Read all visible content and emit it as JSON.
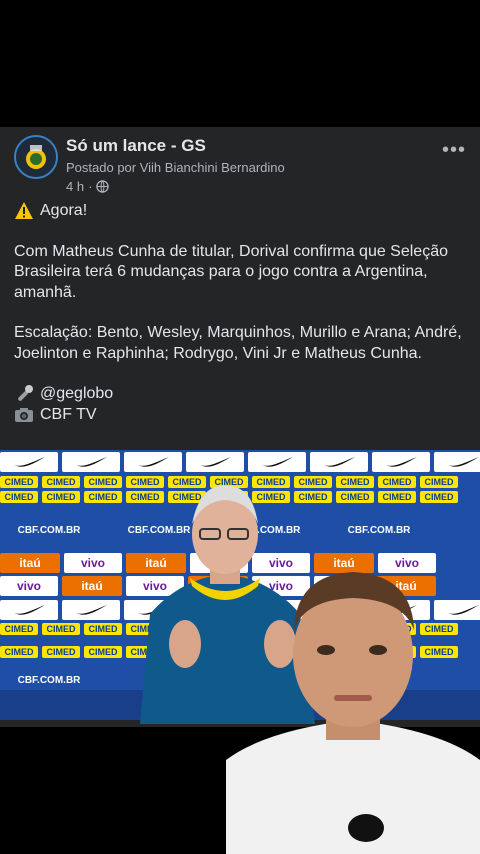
{
  "post": {
    "page_name": "Só um lance - GS",
    "posted_by": "Postado por Viih Bianchini Bernardino",
    "time": "4 h",
    "meta_separator": "·",
    "more_label": "•••",
    "line_alert": "Agora!",
    "paragraph_1": "Com Matheus Cunha de titular, Dorival confirma que Seleção Brasileira terá 6 mudanças para o jogo contra a Argentina, amanhã.",
    "paragraph_2": "Escalação: Bento, Wesley, Marquinhos, Murillo e Arana; André, Joelinton e Raphinha; Rodrygo, Vini Jr e Matheus Cunha.",
    "credit_1": "@geglobo",
    "credit_2": "CBF TV"
  },
  "video": {
    "sponsor_cimed": "CIMED",
    "sponsor_itau": "itaú",
    "sponsor_vivo": "vivo",
    "sponsor_cbf": "CBF.COM.BR"
  },
  "colors": {
    "post_bg": "#242526",
    "text": "#e4e6eb",
    "muted": "#b0b3b8",
    "board_blue": "#1f4ea6"
  }
}
